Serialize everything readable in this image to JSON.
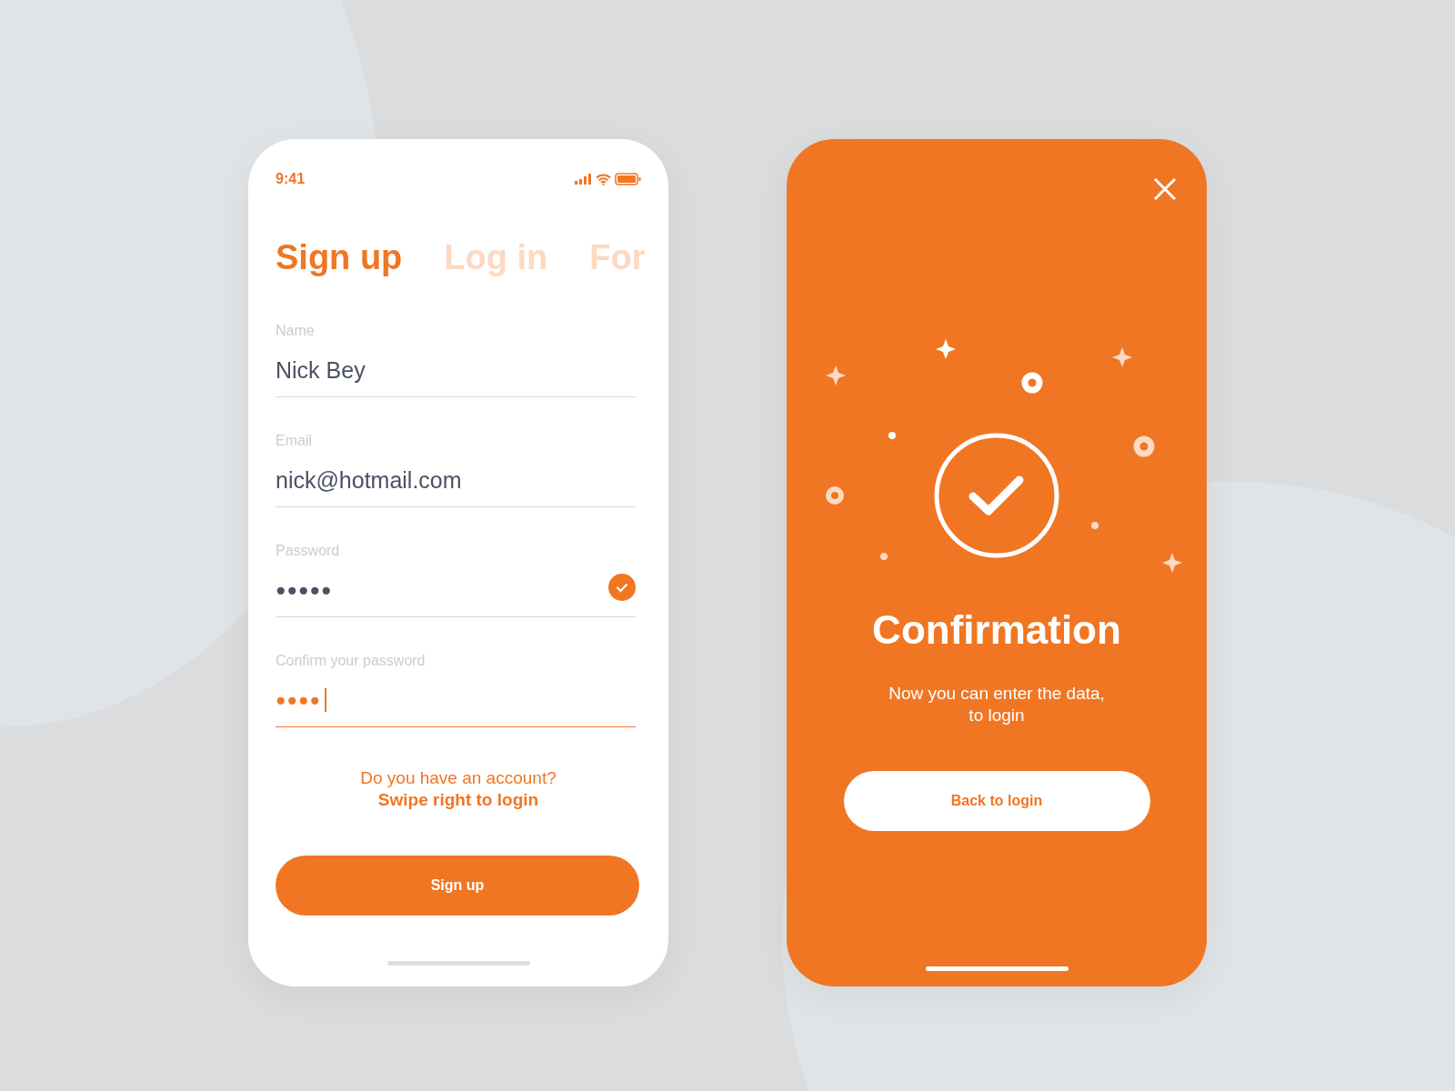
{
  "status_bar": {
    "time": "9:41"
  },
  "tabs": [
    {
      "label": "Sign up",
      "selected": true
    },
    {
      "label": "Log in",
      "selected": false
    },
    {
      "label": "For",
      "selected": false
    }
  ],
  "fields": [
    {
      "label": "Name",
      "value": "Nick Bey",
      "kind": "text",
      "focused": false,
      "valid": false
    },
    {
      "label": "Email",
      "value": "nick@hotmail.com",
      "kind": "text",
      "focused": false,
      "valid": false
    },
    {
      "label": "Password",
      "value": "●●●●●",
      "kind": "password",
      "focused": false,
      "valid": true
    },
    {
      "label": "Confirm your password",
      "value": "●●●●",
      "kind": "password",
      "focused": true,
      "valid": false
    }
  ],
  "account_prompt": {
    "question": "Do you have an account?",
    "link": "Swipe right to login"
  },
  "primary_button": "Sign up",
  "confirmation": {
    "title": "Confirmation",
    "message": [
      "Now you can enter the data,",
      "to login"
    ],
    "button": "Back to login"
  }
}
